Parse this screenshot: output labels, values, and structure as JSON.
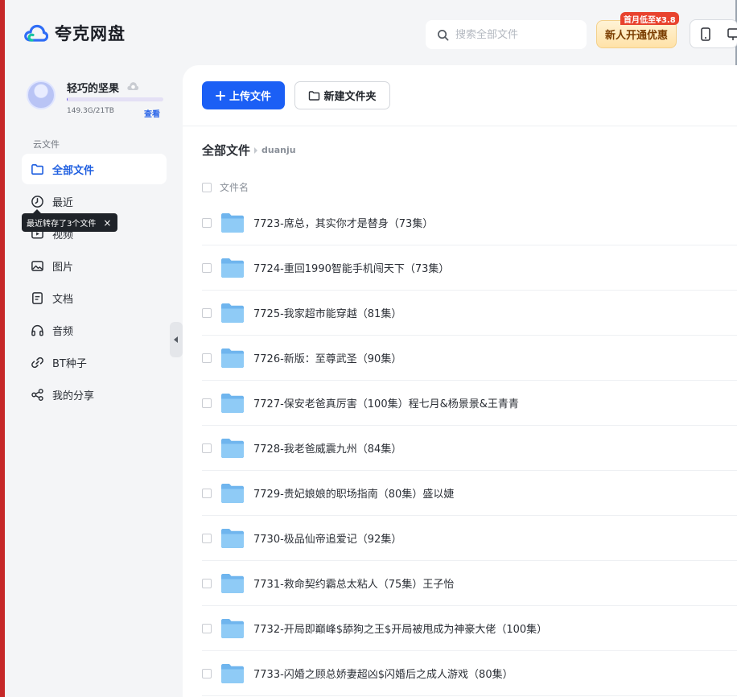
{
  "app": {
    "name": "夸克网盘",
    "search_placeholder": "搜索全部文件",
    "promo_label": "新人开通优惠",
    "promo_badge": "首月低至¥3.8"
  },
  "user": {
    "name": "轻巧的坚果",
    "storage_text": "149.3G/21TB",
    "storage_link": "查看",
    "storage_used_fraction": 0.007
  },
  "sidebar": {
    "section_title": "云文件",
    "items": [
      {
        "label": "全部文件",
        "icon": "folder-icon",
        "active": true
      },
      {
        "label": "最近",
        "icon": "clock-icon",
        "active": false
      },
      {
        "label": "视频",
        "icon": "video-icon",
        "active": false
      },
      {
        "label": "图片",
        "icon": "image-icon",
        "active": false
      },
      {
        "label": "文档",
        "icon": "document-icon",
        "active": false
      },
      {
        "label": "音频",
        "icon": "headphones-icon",
        "active": false
      },
      {
        "label": "BT种子",
        "icon": "link-icon",
        "active": false
      },
      {
        "label": "我的分享",
        "icon": "share-icon",
        "active": false
      }
    ],
    "tooltip": "最近转存了3个文件",
    "tooltip_close": "×"
  },
  "toolbar": {
    "upload_label": "上传文件",
    "new_folder_label": "新建文件夹"
  },
  "breadcrumb": {
    "root": "全部文件",
    "current": "duanju"
  },
  "list": {
    "header": "文件名",
    "files": [
      "7723-席总，其实你才是替身（73集）",
      "7724-重回1990智能手机闯天下（73集）",
      "7725-我家超市能穿越（81集）",
      "7726-新版：至尊武圣（90集）",
      "7727-保安老爸真厉害（100集）程七月&杨景景&王青青",
      "7728-我老爸威震九州（84集）",
      "7729-贵妃娘娘的职场指南（80集）盛以婕",
      "7730-极品仙帝追爱记（92集）",
      "7731-救命契约霸总太粘人（75集）王子怡",
      "7732-开局即巅峰$舔狗之王$开局被甩成为神豪大佬（100集）",
      "7733-闪婚之顾总娇妻超凶$闪婚后之成人游戏（80集）"
    ]
  },
  "colors": {
    "accent": "#1b5ff5",
    "promo_text": "#7a3d00",
    "badge": "#e8432e"
  }
}
